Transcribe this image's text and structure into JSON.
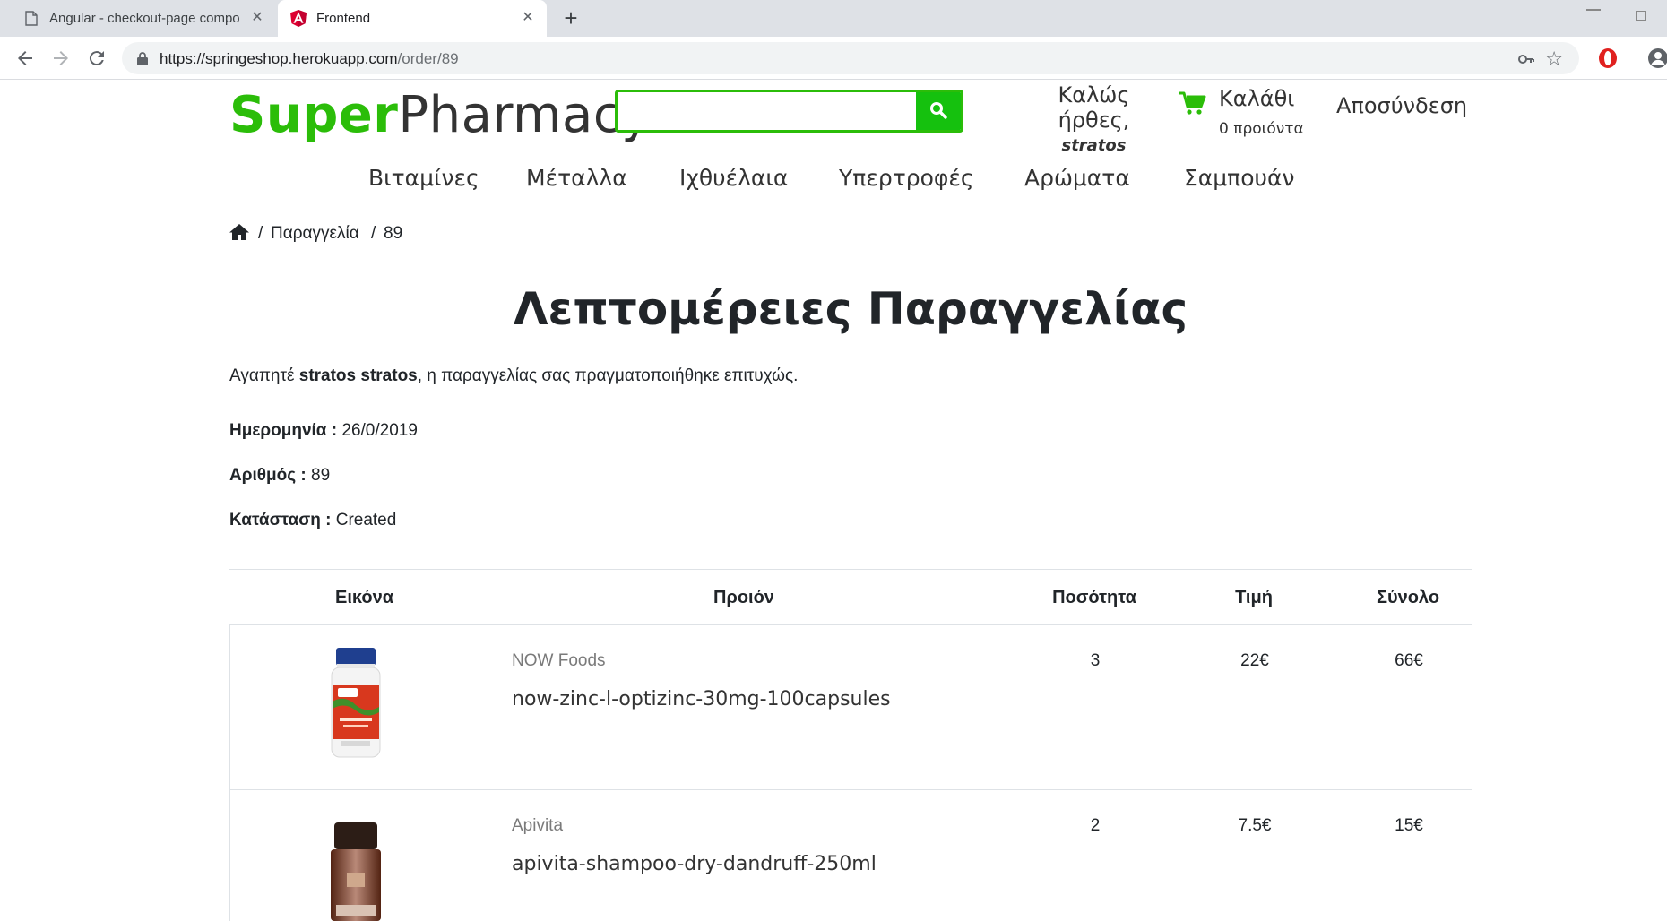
{
  "browser": {
    "tabs": [
      {
        "title": "Angular - checkout-page compo",
        "active": false
      },
      {
        "title": "Frontend",
        "active": true
      }
    ],
    "url_host": "https://springeshop.herokuapp.com",
    "url_path": "/order/89"
  },
  "header": {
    "logo_part1": "Super",
    "logo_part2": "Pharmacy",
    "search_placeholder": "",
    "welcome": "Καλώς ήρθες,",
    "username": "stratos",
    "cart_label": "Καλάθι",
    "cart_count": "0 προιόντα",
    "logout": "Αποσύνδεση",
    "colors": {
      "brand": "#2bbd09",
      "search_button": "#15c10e"
    }
  },
  "categories": [
    "Βιταμίνες",
    "Μέταλλα",
    "Ιχθυέλαια",
    "Υπερτροφές",
    "Αρώματα",
    "Σαμπουάν"
  ],
  "breadcrumb": {
    "sep": "/",
    "section": "Παραγγελία",
    "id": "89"
  },
  "order": {
    "title": "Λεπτομέρειες Παραγγελίας",
    "greeting_prefix": "Αγαπητέ ",
    "customer": "stratos stratos",
    "greeting_suffix": ", η παραγγελίας σας πραγματοποιήθηκε επιτυχώς.",
    "date_label": "Ημερομηνία :",
    "date": "26/0/2019",
    "number_label": "Αριθμός :",
    "number": "89",
    "status_label": "Κατάσταση :",
    "status": "Created"
  },
  "table": {
    "headers": [
      "Εικόνα",
      "Προιόν",
      "Ποσότητα",
      "Τιμή",
      "Σύνολο"
    ],
    "rows": [
      {
        "brand": "NOW Foods",
        "name": "now-zinc-l-optizinc-30mg-100capsules",
        "qty": "3",
        "price": "22€",
        "total": "66€"
      },
      {
        "brand": "Apivita",
        "name": "apivita-shampoo-dry-dandruff-250ml",
        "qty": "2",
        "price": "7.5€",
        "total": "15€"
      }
    ]
  }
}
